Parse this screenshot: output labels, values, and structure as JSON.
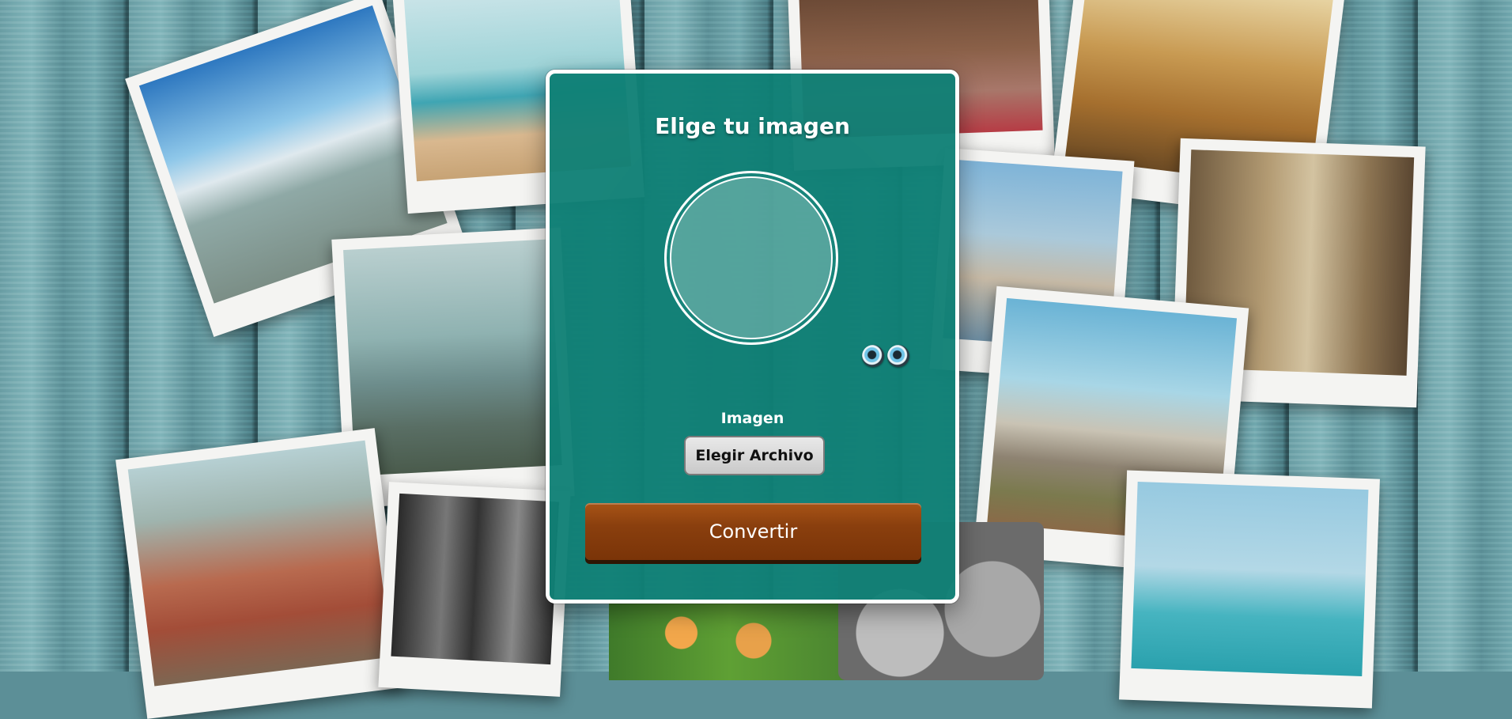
{
  "card": {
    "title": "Elige tu imagen",
    "image_label": "Imagen",
    "file_button_label": "Elegir Archivo",
    "convert_button_label": "Convertir"
  },
  "colors": {
    "card_background": "#108076",
    "card_border": "#ffffff",
    "convert_button": "#8a3f0e",
    "file_button": "#d9d9d9"
  },
  "icons": {
    "preview": "circle-image-placeholder",
    "eyes": "eyes-icon"
  }
}
